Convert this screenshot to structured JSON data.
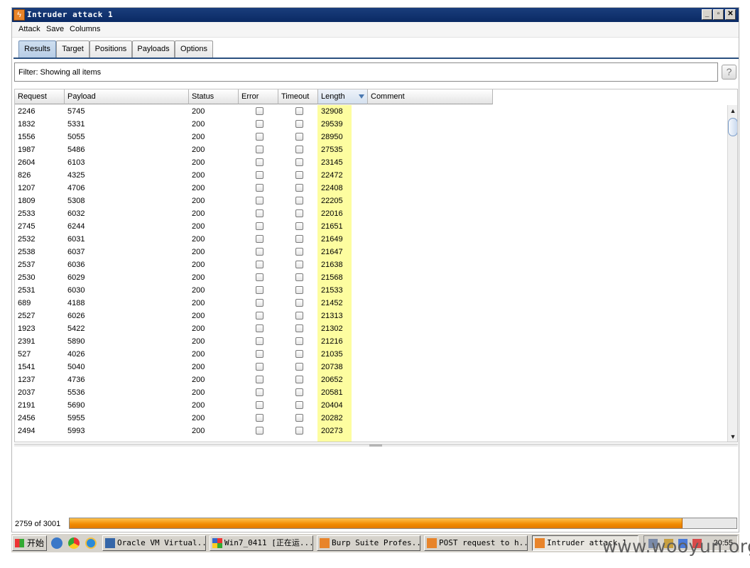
{
  "window": {
    "title": "Intruder attack 1",
    "buttons": {
      "minimize": "_",
      "maximize": "▫",
      "close": "✕"
    }
  },
  "menubar": {
    "items": [
      "Attack",
      "Save",
      "Columns"
    ]
  },
  "tabs": [
    {
      "label": "Results",
      "active": true
    },
    {
      "label": "Target",
      "active": false
    },
    {
      "label": "Positions",
      "active": false
    },
    {
      "label": "Payloads",
      "active": false
    },
    {
      "label": "Options",
      "active": false
    }
  ],
  "filter": {
    "text": "Filter:  Showing all items",
    "help": "?"
  },
  "table": {
    "columns": [
      "Request",
      "Payload",
      "Status",
      "Error",
      "Timeout",
      "Length",
      "Comment"
    ],
    "sorted_column": "Length",
    "highlight_color": "#fdfda0",
    "rows": [
      [
        "2246",
        "5745",
        "200",
        "32908"
      ],
      [
        "1832",
        "5331",
        "200",
        "29539"
      ],
      [
        "1556",
        "5055",
        "200",
        "28950"
      ],
      [
        "1987",
        "5486",
        "200",
        "27535"
      ],
      [
        "2604",
        "6103",
        "200",
        "23145"
      ],
      [
        "826",
        "4325",
        "200",
        "22472"
      ],
      [
        "1207",
        "4706",
        "200",
        "22408"
      ],
      [
        "1809",
        "5308",
        "200",
        "22205"
      ],
      [
        "2533",
        "6032",
        "200",
        "22016"
      ],
      [
        "2745",
        "6244",
        "200",
        "21651"
      ],
      [
        "2532",
        "6031",
        "200",
        "21649"
      ],
      [
        "2538",
        "6037",
        "200",
        "21647"
      ],
      [
        "2537",
        "6036",
        "200",
        "21638"
      ],
      [
        "2530",
        "6029",
        "200",
        "21568"
      ],
      [
        "2531",
        "6030",
        "200",
        "21533"
      ],
      [
        "689",
        "4188",
        "200",
        "21452"
      ],
      [
        "2527",
        "6026",
        "200",
        "21313"
      ],
      [
        "1923",
        "5422",
        "200",
        "21302"
      ],
      [
        "2391",
        "5890",
        "200",
        "21216"
      ],
      [
        "527",
        "4026",
        "200",
        "21035"
      ],
      [
        "1541",
        "5040",
        "200",
        "20738"
      ],
      [
        "1237",
        "4736",
        "200",
        "20652"
      ],
      [
        "2037",
        "5536",
        "200",
        "20581"
      ],
      [
        "2191",
        "5690",
        "200",
        "20404"
      ],
      [
        "2456",
        "5955",
        "200",
        "20282"
      ],
      [
        "2494",
        "5993",
        "200",
        "20273"
      ]
    ]
  },
  "progress": {
    "text": "2759 of 3001",
    "fraction": 0.919,
    "color": "#f08a00"
  },
  "taskbar": {
    "start_label": "开始",
    "buttons": [
      {
        "label": "Oracle VM Virtual...",
        "icon": "virtualbox-icon"
      },
      {
        "label": "Win7_0411 [正在运...",
        "icon": "vm-window-icon"
      },
      {
        "label": "Burp Suite Profes...",
        "icon": "burp-icon"
      },
      {
        "label": "POST request to h...",
        "icon": "burp-icon"
      },
      {
        "label": "Intruder attack 1",
        "icon": "burp-icon",
        "active": true
      }
    ],
    "clock": "20:55"
  },
  "watermark": "www.wooyun.org"
}
